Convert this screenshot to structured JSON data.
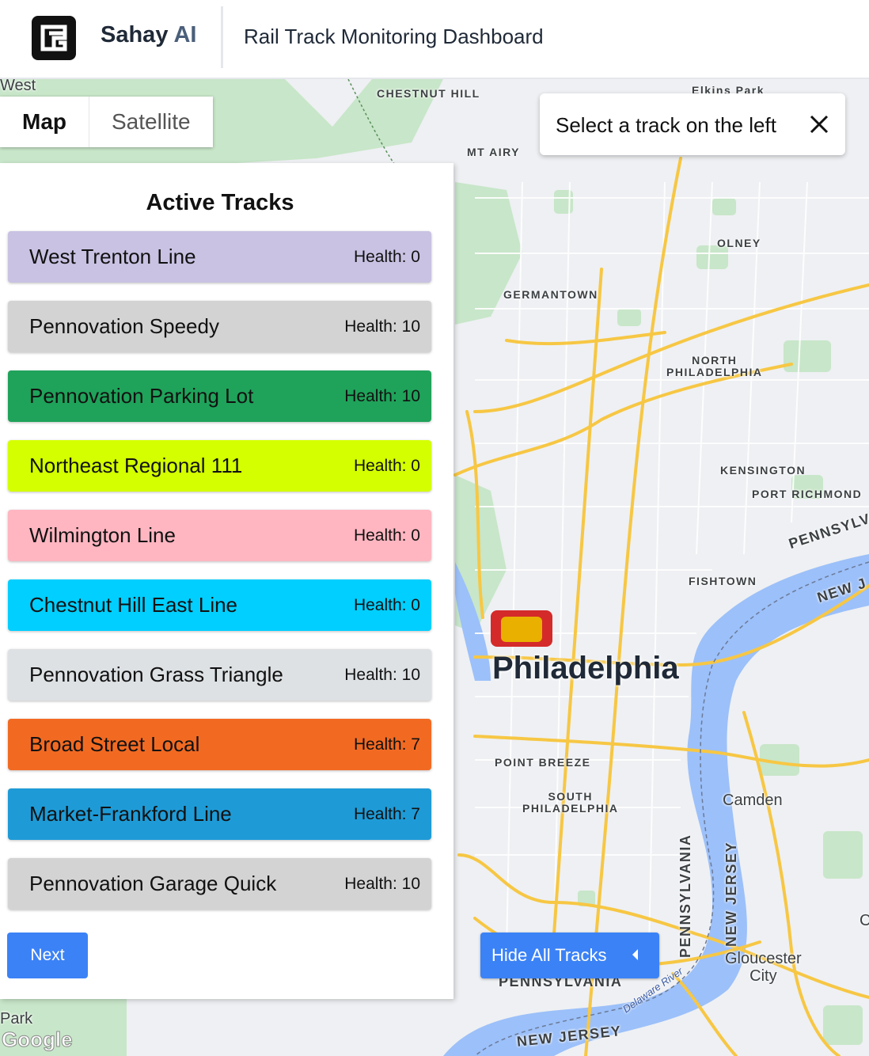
{
  "header": {
    "brand_name": "Sahay",
    "brand_suffix": "AI",
    "title": "Rail Track Monitoring Dashboard"
  },
  "map_type": {
    "options": [
      "Map",
      "Satellite"
    ],
    "selected": "Map"
  },
  "hint": {
    "text": "Select a track on the left"
  },
  "panel": {
    "title": "Active Tracks",
    "tracks": [
      {
        "name": "West Trenton Line",
        "health": "Health: 0",
        "color": "#c9c2e3"
      },
      {
        "name": "Pennovation Speedy",
        "health": "Health: 10",
        "color": "#d3d3d3"
      },
      {
        "name": "Pennovation Parking Lot",
        "health": "Health: 10",
        "color": "#1fa35a"
      },
      {
        "name": "Northeast Regional 111",
        "health": "Health: 0",
        "color": "#d4ff00"
      },
      {
        "name": "Wilmington Line",
        "health": "Health: 0",
        "color": "#ffb6c1"
      },
      {
        "name": "Chestnut Hill East Line",
        "health": "Health: 0",
        "color": "#00cfff"
      },
      {
        "name": "Pennovation Grass Triangle",
        "health": "Health: 10",
        "color": "#dde1e4"
      },
      {
        "name": "Broad Street Local",
        "health": "Health: 7",
        "color": "#f26a22"
      },
      {
        "name": "Market-Frankford Line",
        "health": "Health: 7",
        "color": "#1e9bd7"
      },
      {
        "name": "Pennovation Garage Quick",
        "health": "Health: 10",
        "color": "#d3d3d3"
      }
    ],
    "next_label": "Next"
  },
  "hide_tracks_label": "Hide All Tracks",
  "map_labels": {
    "west": "West",
    "chestnut_hill": "CHESTNUT HILL",
    "elkins_park": "Elkins Park",
    "mt_airy": "MT AIRY",
    "olney": "OLNEY",
    "germantown": "GERMANTOWN",
    "north_philadelphia_1": "NORTH",
    "north_philadelphia_2": "PHILADELPHIA",
    "kensington": "KENSINGTON",
    "port_richmond": "PORT RICHMOND",
    "pennsylvania_ne": "PENNSYLV",
    "new_jersey_ne": "NEW J",
    "fishtown": "FISHTOWN",
    "philadelphia": "Philadelphia",
    "point_breeze": "POINT BREEZE",
    "south_philadelphia_1": "SOUTH",
    "south_philadelphia_2": "PHILADELPHIA",
    "camden": "Camden",
    "pennsylvania_v": "PENNSYLVANIA",
    "new_jersey_v": "NEW JERSEY",
    "gloucester_1": "Gloucester",
    "gloucester_2": "City",
    "pennsylvania_s": "PENNSYLVANIA",
    "delaware_river": "Delaware River",
    "new_jersey_s": "NEW JERSEY",
    "park": "Park",
    "c_edge": "C"
  },
  "attribution": "Google",
  "colors": {
    "accent": "#3b82f6",
    "water": "#9cc0f9",
    "park": "#c8e6c9",
    "highway": "#f7c744"
  }
}
